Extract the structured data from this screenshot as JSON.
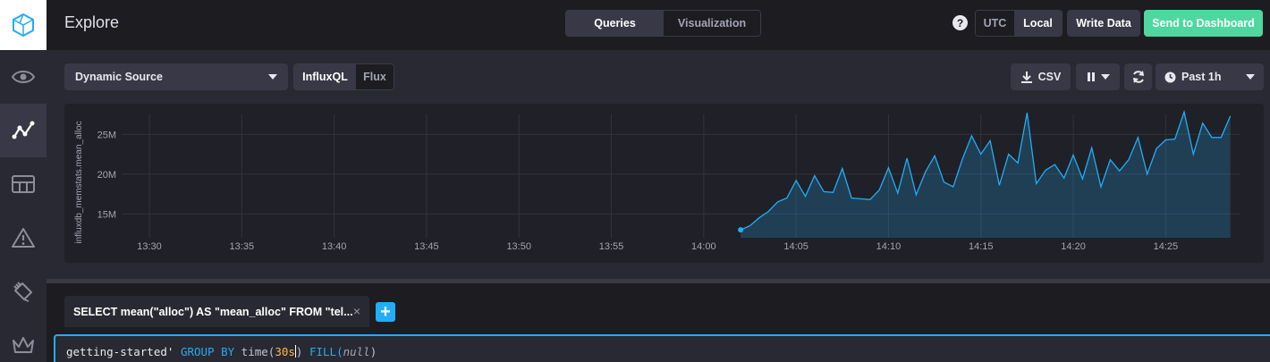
{
  "header": {
    "title": "Explore",
    "view_toggle": [
      "Queries",
      "Visualization"
    ],
    "help_label": "?",
    "timezone_toggle": [
      "UTC",
      "Local"
    ],
    "write_data": "Write Data",
    "send_to_dashboard": "Send to Dashboard"
  },
  "sidebar": {
    "items": [
      {
        "icon": "eye-icon"
      },
      {
        "icon": "graph-icon",
        "active": true
      },
      {
        "icon": "dashboard-grid-icon"
      },
      {
        "icon": "alert-icon"
      },
      {
        "icon": "wrench-icon"
      },
      {
        "icon": "crown-icon"
      }
    ]
  },
  "toolbar": {
    "source": "Dynamic Source",
    "language_toggle": [
      "InfluxQL",
      "Flux"
    ],
    "csv": "CSV",
    "time_range": "Past 1h"
  },
  "chart_data": {
    "type": "line",
    "ylabel": "influxdb_memstats.mean_alloc",
    "y_ticks": [
      "15M",
      "20M",
      "25M"
    ],
    "x_ticks": [
      "13:30",
      "13:35",
      "13:40",
      "13:45",
      "13:50",
      "13:55",
      "14:00",
      "14:05",
      "14:10",
      "14:15",
      "14:20",
      "14:25"
    ],
    "xlim": [
      "13:28:30",
      "14:29:00"
    ],
    "ylim": [
      12000000,
      27500000
    ],
    "series": [
      {
        "color": "#22adf6",
        "fill": true,
        "times": [
          "14:02:00",
          "14:02:30",
          "14:03:00",
          "14:03:30",
          "14:04:00",
          "14:04:30",
          "14:05:00",
          "14:05:30",
          "14:06:00",
          "14:06:30",
          "14:07:00",
          "14:07:30",
          "14:08:00",
          "14:08:30",
          "14:09:00",
          "14:09:30",
          "14:10:00",
          "14:10:30",
          "14:11:00",
          "14:11:30",
          "14:12:00",
          "14:12:30",
          "14:13:00",
          "14:13:30",
          "14:14:00",
          "14:14:30",
          "14:15:00",
          "14:15:30",
          "14:16:00",
          "14:16:30",
          "14:17:00",
          "14:17:30",
          "14:18:00",
          "14:18:30",
          "14:19:00",
          "14:19:30",
          "14:20:00",
          "14:20:30",
          "14:21:00",
          "14:21:30",
          "14:22:00",
          "14:22:30",
          "14:23:00",
          "14:23:30",
          "14:24:00",
          "14:24:30",
          "14:25:00",
          "14:25:30",
          "14:26:00",
          "14:26:30",
          "14:27:00",
          "14:27:30",
          "14:28:00",
          "14:28:30"
        ],
        "values": [
          13000000,
          13500000,
          14500000,
          15300000,
          16500000,
          17000000,
          19200000,
          17200000,
          19800000,
          17800000,
          17700000,
          20700000,
          17000000,
          16900000,
          16800000,
          18000000,
          20800000,
          17600000,
          22000000,
          17400000,
          20300000,
          22300000,
          19000000,
          18400000,
          21900000,
          24800000,
          22500000,
          24200000,
          18600000,
          22500000,
          21400000,
          27700000,
          18800000,
          20500000,
          21200000,
          19500000,
          22400000,
          19400000,
          23300000,
          18400000,
          21800000,
          20400000,
          21800000,
          24600000,
          20000000,
          23200000,
          24300000,
          24400000,
          27800000,
          22500000,
          26400000,
          24600000,
          24600000,
          27300000,
          24300000
        ]
      }
    ]
  },
  "query": {
    "tab_label": "SELECT mean(\"alloc\") AS \"mean_alloc\" FROM \"tel...",
    "close": "×",
    "add": "+",
    "line_a": "getting-started' ",
    "kw_group": "GROUP BY ",
    "fn_time": "time(",
    "num_30": "30",
    "unit_s": "s",
    "close_paren": ") ",
    "kw_fill": "FILL(",
    "nul": "null",
    "end_paren": ")"
  }
}
